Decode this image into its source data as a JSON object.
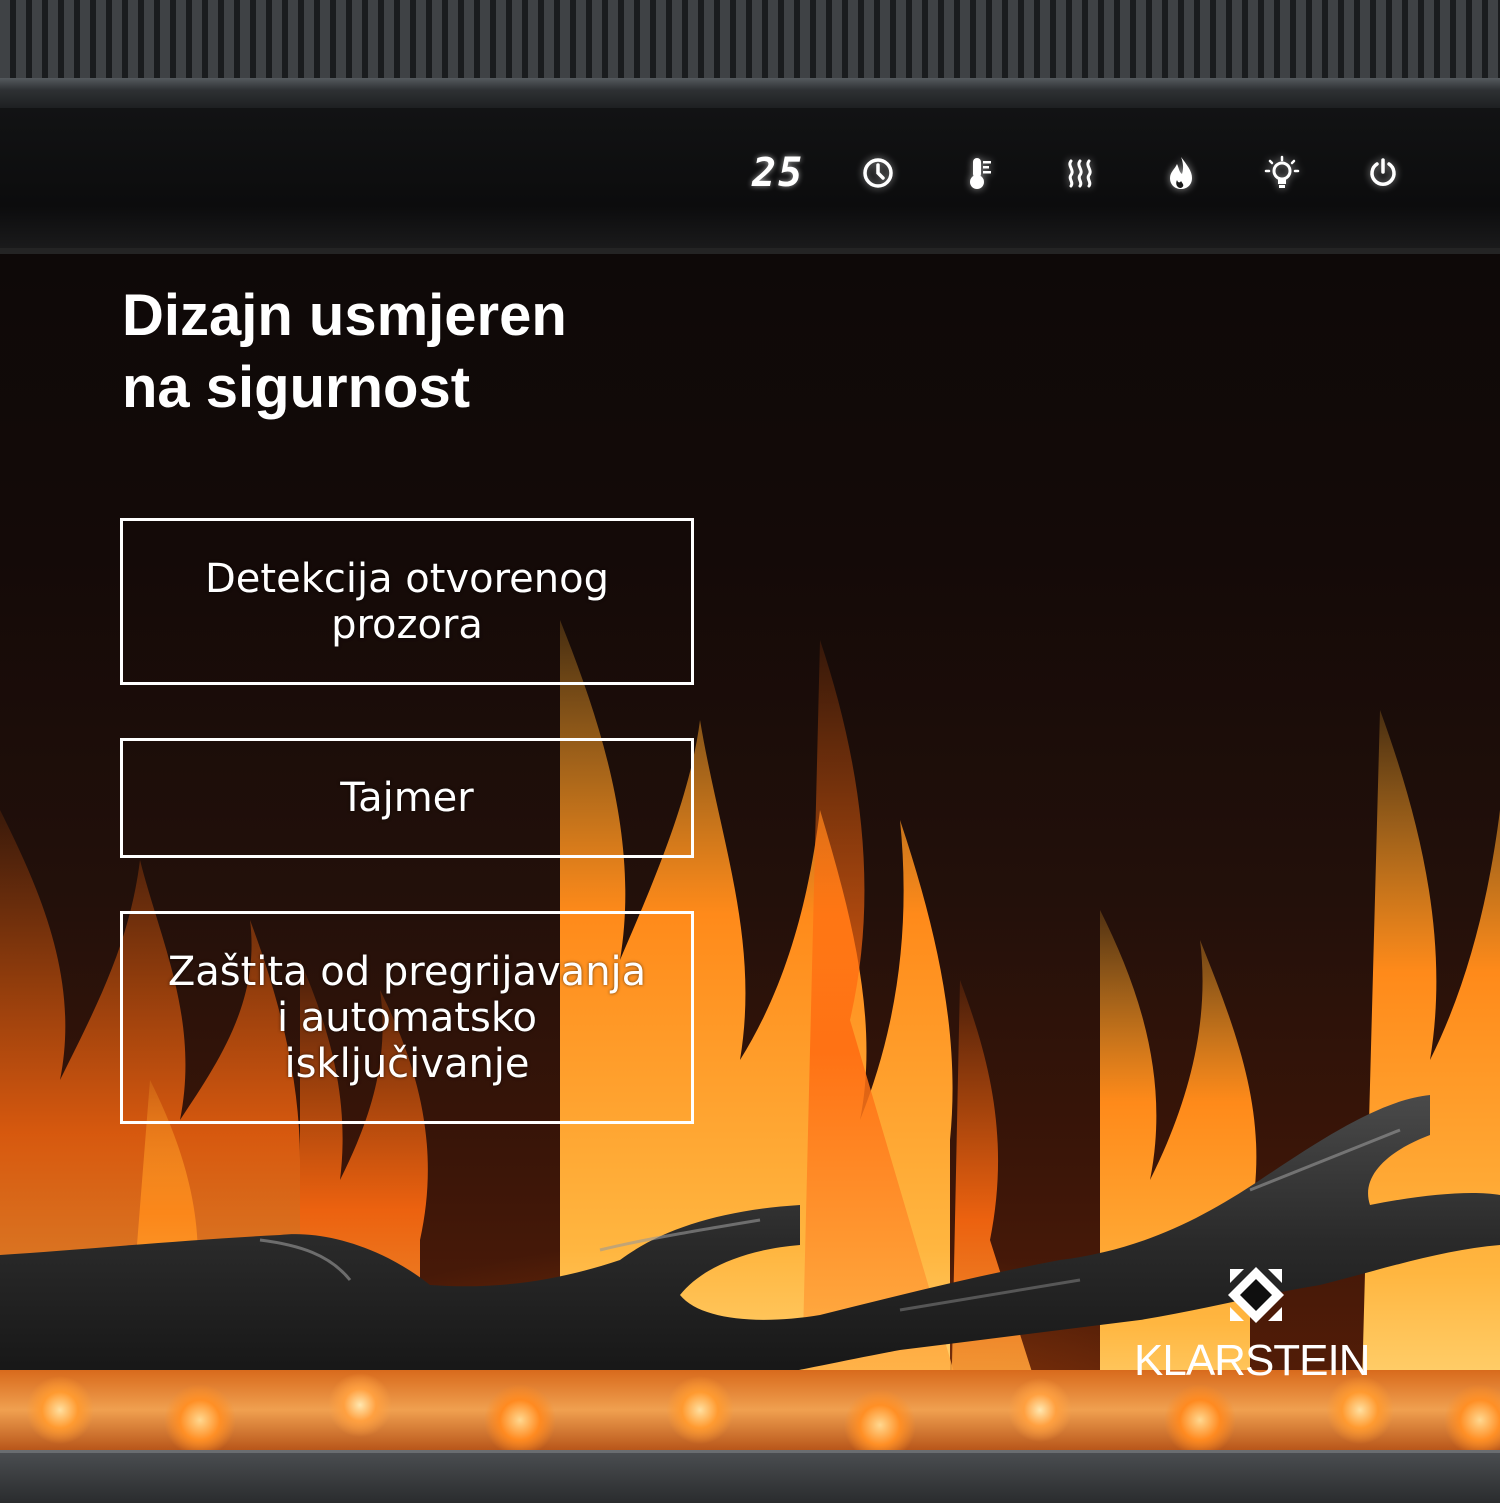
{
  "headline": {
    "line1": "Dizajn usmjeren",
    "line2": "na sigurnost"
  },
  "control_panel": {
    "temperature_display": "25",
    "icons": [
      "timer-icon",
      "thermostat-icon",
      "heat-icon",
      "flame-icon",
      "light-bulb-icon",
      "power-icon"
    ]
  },
  "features": [
    {
      "lines": [
        "Detekcija otvorenog",
        "prozora"
      ]
    },
    {
      "lines": [
        "Tajmer"
      ]
    },
    {
      "lines": [
        "Zaštita od pregrijavanja",
        "i automatsko",
        "isključivanje"
      ]
    }
  ],
  "brand": {
    "name": "KLARSTEIN"
  },
  "colors": {
    "text": "#ffffff",
    "flame_orange": "#ff7a12",
    "flame_yellow": "#ffc04a",
    "panel": "#0c0c0d",
    "frame": "#3f4245"
  }
}
